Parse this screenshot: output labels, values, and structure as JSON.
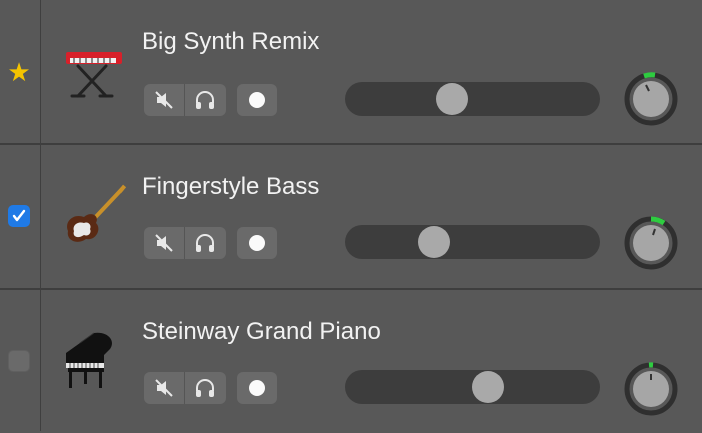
{
  "colors": {
    "accent": "#1f7ae6",
    "star": "#f5c400",
    "pan_green": "#2ecc40"
  },
  "tracks": [
    {
      "name": "Big Synth Remix",
      "status": "favorite-star",
      "instrument_icon": "synth-keyboard-icon",
      "volume": 0.42,
      "pan_knob": "center"
    },
    {
      "name": "Fingerstyle Bass",
      "status": "checked",
      "instrument_icon": "bass-guitar-icon",
      "volume": 0.35,
      "pan_knob": "slightly-right"
    },
    {
      "name": "Steinway Grand Piano",
      "status": "unchecked",
      "instrument_icon": "grand-piano-icon",
      "volume": 0.56,
      "pan_knob": "center"
    }
  ],
  "buttons": {
    "mute": "mute-icon",
    "solo": "headphones-icon",
    "record": "record-icon"
  }
}
